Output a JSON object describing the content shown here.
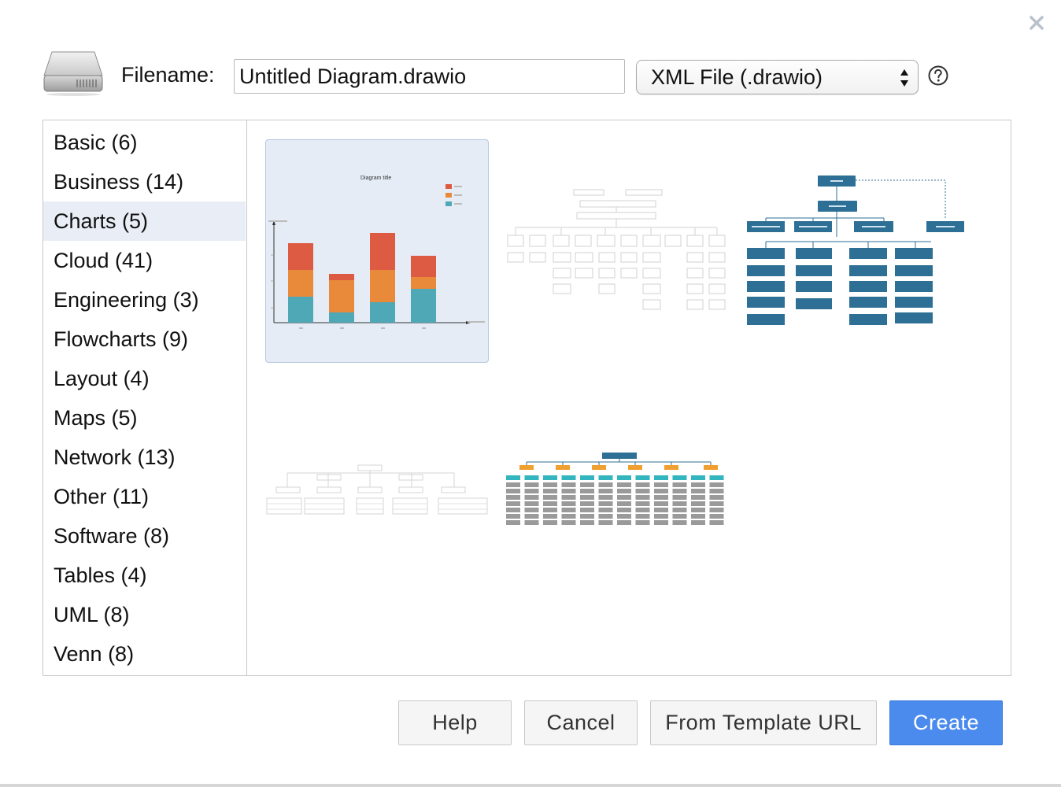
{
  "dialog": {
    "filename_label": "Filename:",
    "filename_value": "Untitled Diagram.drawio",
    "format_selected": "XML File (.drawio)",
    "close_icon": "close-icon",
    "help_icon": "question-circle-icon",
    "drive_icon": "hard-drive-icon"
  },
  "categories": [
    {
      "label": "Basic (6)",
      "selected": false
    },
    {
      "label": "Business (14)",
      "selected": false
    },
    {
      "label": "Charts (5)",
      "selected": true
    },
    {
      "label": "Cloud (41)",
      "selected": false
    },
    {
      "label": "Engineering (3)",
      "selected": false
    },
    {
      "label": "Flowcharts (9)",
      "selected": false
    },
    {
      "label": "Layout (4)",
      "selected": false
    },
    {
      "label": "Maps (5)",
      "selected": false
    },
    {
      "label": "Network (13)",
      "selected": false
    },
    {
      "label": "Other (11)",
      "selected": false
    },
    {
      "label": "Software (8)",
      "selected": false
    },
    {
      "label": "Tables (4)",
      "selected": false
    },
    {
      "label": "UML (8)",
      "selected": false
    },
    {
      "label": "Venn (8)",
      "selected": false
    }
  ],
  "templates": [
    {
      "name": "stacked-bar-chart",
      "selected": true,
      "title": "Diagram title"
    },
    {
      "name": "gray-org-chart",
      "selected": false
    },
    {
      "name": "blue-org-chart",
      "selected": false
    },
    {
      "name": "wide-hierarchy-chart",
      "selected": false
    },
    {
      "name": "team-grid-chart",
      "selected": false
    }
  ],
  "buttons": {
    "help": "Help",
    "cancel": "Cancel",
    "template_url": "From Template URL",
    "create": "Create"
  },
  "colors": {
    "accent": "#4a8bed",
    "selected_bg": "#e9eef6",
    "series_red": "#dd5a43",
    "series_orange": "#e9893a",
    "series_teal": "#4fa8b6",
    "org_blue": "#2e6f95",
    "grid_orange": "#f0a030",
    "grid_teal": "#33b5c0"
  }
}
